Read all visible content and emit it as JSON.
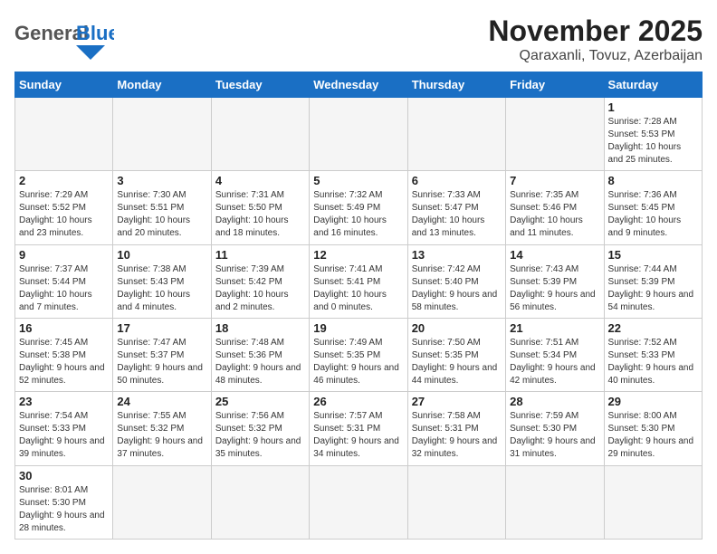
{
  "header": {
    "logo_general": "General",
    "logo_blue": "Blue",
    "title": "November 2025",
    "subtitle": "Qaraxanli, Tovuz, Azerbaijan"
  },
  "days_of_week": [
    "Sunday",
    "Monday",
    "Tuesday",
    "Wednesday",
    "Thursday",
    "Friday",
    "Saturday"
  ],
  "weeks": [
    [
      {
        "day": "",
        "info": ""
      },
      {
        "day": "",
        "info": ""
      },
      {
        "day": "",
        "info": ""
      },
      {
        "day": "",
        "info": ""
      },
      {
        "day": "",
        "info": ""
      },
      {
        "day": "",
        "info": ""
      },
      {
        "day": "1",
        "info": "Sunrise: 7:28 AM\nSunset: 5:53 PM\nDaylight: 10 hours and 25 minutes."
      }
    ],
    [
      {
        "day": "2",
        "info": "Sunrise: 7:29 AM\nSunset: 5:52 PM\nDaylight: 10 hours and 23 minutes."
      },
      {
        "day": "3",
        "info": "Sunrise: 7:30 AM\nSunset: 5:51 PM\nDaylight: 10 hours and 20 minutes."
      },
      {
        "day": "4",
        "info": "Sunrise: 7:31 AM\nSunset: 5:50 PM\nDaylight: 10 hours and 18 minutes."
      },
      {
        "day": "5",
        "info": "Sunrise: 7:32 AM\nSunset: 5:49 PM\nDaylight: 10 hours and 16 minutes."
      },
      {
        "day": "6",
        "info": "Sunrise: 7:33 AM\nSunset: 5:47 PM\nDaylight: 10 hours and 13 minutes."
      },
      {
        "day": "7",
        "info": "Sunrise: 7:35 AM\nSunset: 5:46 PM\nDaylight: 10 hours and 11 minutes."
      },
      {
        "day": "8",
        "info": "Sunrise: 7:36 AM\nSunset: 5:45 PM\nDaylight: 10 hours and 9 minutes."
      }
    ],
    [
      {
        "day": "9",
        "info": "Sunrise: 7:37 AM\nSunset: 5:44 PM\nDaylight: 10 hours and 7 minutes."
      },
      {
        "day": "10",
        "info": "Sunrise: 7:38 AM\nSunset: 5:43 PM\nDaylight: 10 hours and 4 minutes."
      },
      {
        "day": "11",
        "info": "Sunrise: 7:39 AM\nSunset: 5:42 PM\nDaylight: 10 hours and 2 minutes."
      },
      {
        "day": "12",
        "info": "Sunrise: 7:41 AM\nSunset: 5:41 PM\nDaylight: 10 hours and 0 minutes."
      },
      {
        "day": "13",
        "info": "Sunrise: 7:42 AM\nSunset: 5:40 PM\nDaylight: 9 hours and 58 minutes."
      },
      {
        "day": "14",
        "info": "Sunrise: 7:43 AM\nSunset: 5:39 PM\nDaylight: 9 hours and 56 minutes."
      },
      {
        "day": "15",
        "info": "Sunrise: 7:44 AM\nSunset: 5:39 PM\nDaylight: 9 hours and 54 minutes."
      }
    ],
    [
      {
        "day": "16",
        "info": "Sunrise: 7:45 AM\nSunset: 5:38 PM\nDaylight: 9 hours and 52 minutes."
      },
      {
        "day": "17",
        "info": "Sunrise: 7:47 AM\nSunset: 5:37 PM\nDaylight: 9 hours and 50 minutes."
      },
      {
        "day": "18",
        "info": "Sunrise: 7:48 AM\nSunset: 5:36 PM\nDaylight: 9 hours and 48 minutes."
      },
      {
        "day": "19",
        "info": "Sunrise: 7:49 AM\nSunset: 5:35 PM\nDaylight: 9 hours and 46 minutes."
      },
      {
        "day": "20",
        "info": "Sunrise: 7:50 AM\nSunset: 5:35 PM\nDaylight: 9 hours and 44 minutes."
      },
      {
        "day": "21",
        "info": "Sunrise: 7:51 AM\nSunset: 5:34 PM\nDaylight: 9 hours and 42 minutes."
      },
      {
        "day": "22",
        "info": "Sunrise: 7:52 AM\nSunset: 5:33 PM\nDaylight: 9 hours and 40 minutes."
      }
    ],
    [
      {
        "day": "23",
        "info": "Sunrise: 7:54 AM\nSunset: 5:33 PM\nDaylight: 9 hours and 39 minutes."
      },
      {
        "day": "24",
        "info": "Sunrise: 7:55 AM\nSunset: 5:32 PM\nDaylight: 9 hours and 37 minutes."
      },
      {
        "day": "25",
        "info": "Sunrise: 7:56 AM\nSunset: 5:32 PM\nDaylight: 9 hours and 35 minutes."
      },
      {
        "day": "26",
        "info": "Sunrise: 7:57 AM\nSunset: 5:31 PM\nDaylight: 9 hours and 34 minutes."
      },
      {
        "day": "27",
        "info": "Sunrise: 7:58 AM\nSunset: 5:31 PM\nDaylight: 9 hours and 32 minutes."
      },
      {
        "day": "28",
        "info": "Sunrise: 7:59 AM\nSunset: 5:30 PM\nDaylight: 9 hours and 31 minutes."
      },
      {
        "day": "29",
        "info": "Sunrise: 8:00 AM\nSunset: 5:30 PM\nDaylight: 9 hours and 29 minutes."
      }
    ],
    [
      {
        "day": "30",
        "info": "Sunrise: 8:01 AM\nSunset: 5:30 PM\nDaylight: 9 hours and 28 minutes."
      },
      {
        "day": "",
        "info": ""
      },
      {
        "day": "",
        "info": ""
      },
      {
        "day": "",
        "info": ""
      },
      {
        "day": "",
        "info": ""
      },
      {
        "day": "",
        "info": ""
      },
      {
        "day": "",
        "info": ""
      }
    ]
  ]
}
